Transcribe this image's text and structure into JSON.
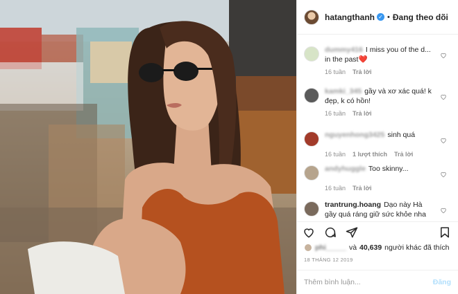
{
  "header": {
    "username": "hatangthanh",
    "separator": "•",
    "follow_status": "Đang theo dõi"
  },
  "comments": [
    {
      "username": "dummy416",
      "username_blurred": true,
      "text": "I miss you of the d... in the past❤️",
      "time": "16 tuần",
      "likes": "",
      "reply": "Trả lời"
    },
    {
      "username": "kamki_345",
      "username_blurred": true,
      "text": "gầy và xơ xác quá! k đẹp, k có hồn!",
      "time": "16 tuần",
      "likes": "",
      "reply": "Trả lời"
    },
    {
      "username": "nguyenhong3425",
      "username_blurred": true,
      "text": "sinh quá",
      "time": "16 tuần",
      "likes": "1 lượt thích",
      "reply": "Trả lời"
    },
    {
      "username": "andyhuggle",
      "username_blurred": true,
      "text": "Too skinny...",
      "time": "16 tuần",
      "likes": "",
      "reply": "Trả lời"
    },
    {
      "username": "trantrung.hoang",
      "username_blurred": false,
      "text": "Dạo này Hà gầy quá ráng giữ sức khỏe nha em",
      "time": "",
      "likes": "",
      "reply": ""
    }
  ],
  "likes": {
    "liker_blurred": "phi_____",
    "connector": "và",
    "count": "40,639",
    "suffix": "người khác đã thích"
  },
  "date": "18 THÁNG 12 2019",
  "add_comment": {
    "placeholder": "Thêm bình luận...",
    "post_label": "Đăng"
  },
  "colors": {
    "verified": "#3897f0",
    "post_disabled": "#b2dffc",
    "meta_gray": "#8e8e8e",
    "heart_red": "#e0245e"
  },
  "icons": {
    "like": "heart-outline-icon",
    "comment": "speech-bubble-icon",
    "share": "paper-plane-icon",
    "save": "bookmark-icon"
  }
}
